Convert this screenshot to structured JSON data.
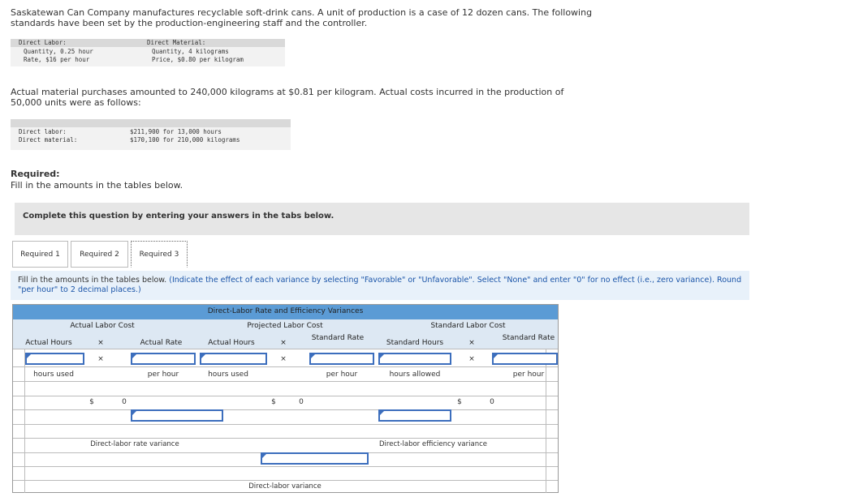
{
  "intro": "Saskatewan Can Company manufactures recyclable soft-drink cans. A unit of production is a case of 12 dozen cans. The following standards have been set by the production-engineering staff and the controller.",
  "standards": {
    "labor_header": "Direct Labor:",
    "labor_qty": "Quantity, 0.25 hour",
    "labor_rate": "Rate, $16 per hour",
    "material_header": "Direct Material:",
    "material_qty": "Quantity, 4 kilograms",
    "material_price": "Price, $0.80 per kilogram"
  },
  "actual_text": "Actual material purchases amounted to 240,000 kilograms at $0.81 per kilogram. Actual costs incurred in the production of 50,000 units were as follows:",
  "actual": {
    "labor_label": "Direct labor:",
    "material_label": "Direct material:",
    "labor_value": "$211,900 for 13,000 hours",
    "material_value": "$170,100 for 210,000 kilograms"
  },
  "required_title": "Required:",
  "required_sub": "Fill in the amounts in the tables below.",
  "complete_banner": "Complete this question by entering your answers in the tabs below.",
  "tabs": [
    "Required 1",
    "Required 2",
    "Required 3"
  ],
  "instructions_plain": "Fill in the amounts in the tables below.",
  "instructions_blue": "(Indicate the effect of each variance by selecting \"Favorable\" or \"Unfavorable\". Select \"None\" and enter \"0\" for no effect (i.e., zero variance). Round \"per hour\" to 2 decimal places.)",
  "table": {
    "title": "Direct-Labor Rate and Efficiency Variances",
    "groups": [
      "Actual Labor Cost",
      "Projected Labor Cost",
      "Standard Labor Cost"
    ],
    "col_actual_hours": "Actual Hours",
    "col_actual_rate": "Actual Rate",
    "col_standard_rate": "Standard Rate",
    "col_standard_hours": "Standard Hours",
    "times": "×",
    "unit_hours_used": "hours used",
    "unit_per_hour": "per hour",
    "unit_hours_allowed": "hours allowed",
    "dollar": "$",
    "zero": "0",
    "rate_variance": "Direct-labor rate variance",
    "efficiency_variance": "Direct-labor efficiency variance",
    "labor_variance": "Direct-labor variance"
  }
}
